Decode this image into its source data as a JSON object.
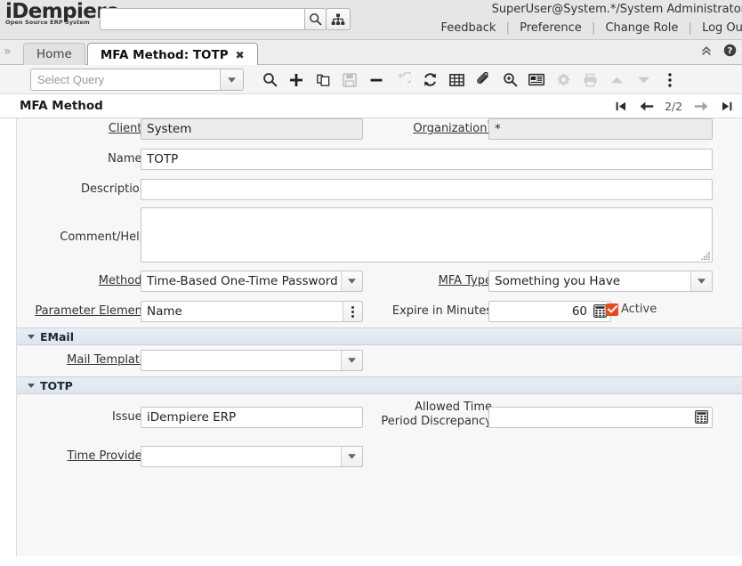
{
  "header": {
    "logo_main": "iDempiere",
    "logo_sub": "Open Source ERP System",
    "search_placeholder": "",
    "search_value": "",
    "user_info": "SuperUser@System.*/System Administrator",
    "links": [
      {
        "label": "Feedback"
      },
      {
        "label": "Preference"
      },
      {
        "label": "Change Role"
      },
      {
        "label": "Log Out"
      }
    ],
    "separator": "|",
    "search_icon": "search-icon",
    "tree_icon": "hierarchy-icon"
  },
  "tabs": {
    "expand_icon": "»",
    "items": [
      {
        "label": "Home",
        "active": false,
        "closable": false
      },
      {
        "label": "MFA Method: TOTP",
        "active": true,
        "closable": true
      }
    ],
    "close_glyph": "✖",
    "collapse_icon": "collapse-chevrons-icon",
    "help_icon": "help-icon"
  },
  "toolbar": {
    "query_placeholder": "Select Query",
    "query_value": "",
    "buttons": [
      {
        "name": "find-button",
        "icon": "search-icon",
        "enabled": true
      },
      {
        "name": "new-button",
        "icon": "plus-icon",
        "enabled": true
      },
      {
        "name": "copy-button",
        "icon": "copy-icon",
        "enabled": true
      },
      {
        "name": "save-button",
        "icon": "save-icon",
        "enabled": false
      },
      {
        "name": "delete-button",
        "icon": "minus-icon",
        "enabled": true
      },
      {
        "name": "undo-button",
        "icon": "undo-icon",
        "enabled": false
      },
      {
        "name": "refresh-button",
        "icon": "refresh-icon",
        "enabled": true
      },
      {
        "name": "grid-toggle-button",
        "icon": "grid-icon",
        "enabled": true
      },
      {
        "name": "attachment-button",
        "icon": "paperclip-icon",
        "enabled": true
      },
      {
        "name": "zoom-across-button",
        "icon": "zoom-in-icon",
        "enabled": true
      },
      {
        "name": "report-button",
        "icon": "report-icon",
        "enabled": true
      },
      {
        "name": "process-button",
        "icon": "gear-icon",
        "enabled": false
      },
      {
        "name": "print-button",
        "icon": "printer-icon",
        "enabled": false
      },
      {
        "name": "parent-record-button",
        "icon": "chevron-up-icon",
        "enabled": false
      },
      {
        "name": "detail-record-button",
        "icon": "chevron-down-icon",
        "enabled": false
      },
      {
        "name": "more-menu-button",
        "icon": "vertical-dots-icon",
        "enabled": true
      }
    ]
  },
  "panel": {
    "title": "MFA Method",
    "record_position": "2/2",
    "nav": {
      "first": "first-record-icon",
      "previous": "previous-record-icon",
      "next": "next-record-icon",
      "last": "last-record-icon"
    }
  },
  "form": {
    "client": {
      "label": "Client",
      "required": "*",
      "value": "System"
    },
    "organization": {
      "label": "Organization",
      "required": "*",
      "value": "*"
    },
    "name": {
      "label": "Name",
      "required": "*",
      "value": "TOTP"
    },
    "description": {
      "label": "Description",
      "value": ""
    },
    "comment_help": {
      "label": "Comment/Help",
      "value": ""
    },
    "method": {
      "label": "Method",
      "required": "*",
      "value": "Time-Based One-Time Password"
    },
    "mfa_type": {
      "label": "MFA Type",
      "value": "Something you Have"
    },
    "parameter_element": {
      "label": "Parameter Element",
      "value": "Name"
    },
    "expire_in_minutes": {
      "label": "Expire in Minutes",
      "value": "60"
    },
    "active": {
      "label": "Active",
      "checked": true
    },
    "groups": {
      "email": {
        "label": "EMail",
        "expanded": true
      },
      "totp": {
        "label": "TOTP",
        "expanded": true
      }
    },
    "mail_template": {
      "label": "Mail Template",
      "value": ""
    },
    "issuer": {
      "label": "Issuer",
      "value": "iDempiere ERP"
    },
    "time_provider": {
      "label": "Time Provider",
      "value": ""
    },
    "allowed_discrepancy": {
      "label_line1": "Allowed Time",
      "label_line2": "Period Discrepancy",
      "value": ""
    }
  },
  "colors": {
    "accent": "#e8491f",
    "header_bg": "#e6e6e6",
    "form_bg": "#f7f7f7",
    "group_bar": "#e1e8f1"
  }
}
